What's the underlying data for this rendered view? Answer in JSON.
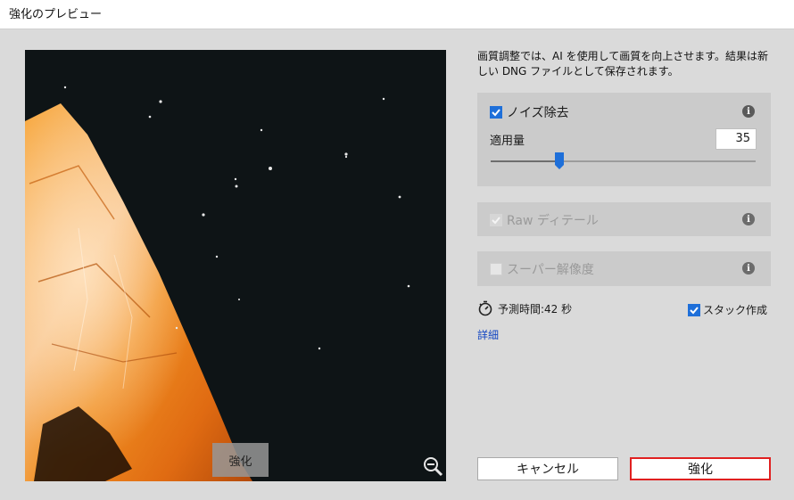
{
  "window": {
    "title": "強化のプレビュー"
  },
  "preview": {
    "toggle_label": "強化",
    "zoom_icon": "zoom-out-icon"
  },
  "description": "画質調整では、AI を使用して画質を向上させます。結果は新しい DNG ファイルとして保存されます。",
  "noise_reduction": {
    "label": "ノイズ除去",
    "checked": true,
    "amount_label": "適用量",
    "amount_value": "35",
    "amount_fraction": 0.26
  },
  "raw_details": {
    "label": "Raw ディテール",
    "checked": true,
    "enabled": false
  },
  "super_resolution": {
    "label": "スーパー解像度",
    "checked": false,
    "enabled": false
  },
  "estimate": {
    "text": "予測時間:42 秒",
    "icon": "stopwatch-icon"
  },
  "stack": {
    "label": "スタック作成",
    "checked": true
  },
  "details_link": "詳細",
  "buttons": {
    "cancel": "キャンセル",
    "enhance": "強化"
  },
  "colors": {
    "accent": "#1e6fd9",
    "highlight_border": "#e02020",
    "link": "#1447c2"
  }
}
